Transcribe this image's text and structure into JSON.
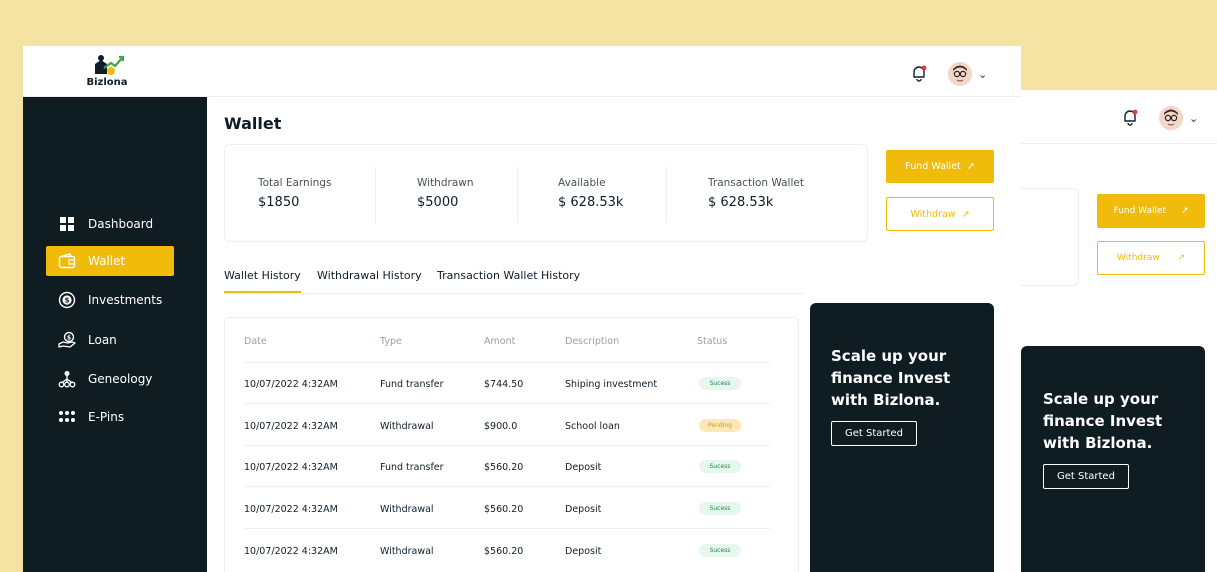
{
  "brand": {
    "name": "Bizlona"
  },
  "header": {
    "notification_icon": "bell-icon",
    "avatar_icon": "avatar-icon",
    "menu_icon": "chevron-down-icon"
  },
  "sidebar": {
    "items": [
      {
        "label": "Dashboard",
        "icon": "grid-icon",
        "active": false
      },
      {
        "label": "Wallet",
        "icon": "wallet-icon",
        "active": true
      },
      {
        "label": "Investments",
        "icon": "coin-icon",
        "active": false
      },
      {
        "label": "Loan",
        "icon": "hand-money-icon",
        "active": false
      },
      {
        "label": "Geneology",
        "icon": "network-icon",
        "active": false
      },
      {
        "label": "E-Pins",
        "icon": "dots-grid-icon",
        "active": false
      }
    ]
  },
  "page": {
    "title": "Wallet"
  },
  "stats": [
    {
      "label": "Total Earnings",
      "value": "$1850"
    },
    {
      "label": "Withdrawn",
      "value": "$5000"
    },
    {
      "label": "Available",
      "value": "$ 628.53k"
    },
    {
      "label": "Transaction Wallet",
      "value": "$ 628.53k"
    }
  ],
  "actions": {
    "fund": "Fund Wallet",
    "withdraw": "Withdraw",
    "arrow": "↗"
  },
  "tabs": [
    {
      "label": "Wallet History",
      "active": true
    },
    {
      "label": "Withdrawal History",
      "active": false
    },
    {
      "label": "Transaction Wallet History",
      "active": false
    }
  ],
  "table": {
    "headers": [
      "Date",
      "Type",
      "Amont",
      "Description",
      "Status"
    ],
    "rows": [
      {
        "date": "10/07/2022  4:32AM",
        "type": "Fund transfer",
        "amount": "$744.50",
        "description": "Shiping investment",
        "status": "Sucess",
        "status_kind": "success"
      },
      {
        "date": "10/07/2022  4:32AM",
        "type": "Withdrawal",
        "amount": "$900.0",
        "description": "School loan",
        "status": "Pending",
        "status_kind": "pending"
      },
      {
        "date": "10/07/2022  4:32AM",
        "type": "Fund transfer",
        "amount": "$560.20",
        "description": "Deposit",
        "status": "Sucess",
        "status_kind": "success"
      },
      {
        "date": "10/07/2022  4:32AM",
        "type": "Withdrawal",
        "amount": "$560.20",
        "description": "Deposit",
        "status": "Sucess",
        "status_kind": "success"
      },
      {
        "date": "10/07/2022  4:32AM",
        "type": "Withdrawal",
        "amount": "$560.20",
        "description": "Deposit",
        "status": "Sucess",
        "status_kind": "success"
      }
    ]
  },
  "promo": {
    "text": "Scale up your finance Invest with Bizlona.",
    "button": "Get Started"
  },
  "colors": {
    "accent": "#f0bb0b",
    "sidebar": "#0f1d23",
    "background": "#f5e3a3",
    "success": "#1c8a4e",
    "pending": "#c99a0b"
  }
}
